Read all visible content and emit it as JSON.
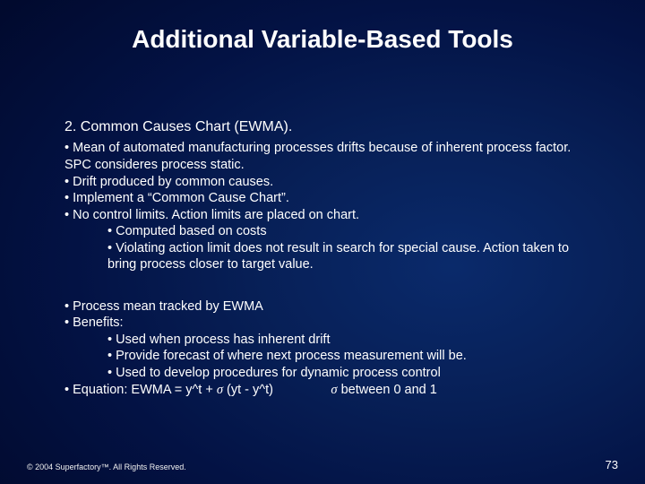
{
  "title": "Additional Variable-Based Tools",
  "heading": "2. Common Causes Chart (EWMA).",
  "block1": {
    "b1": "• Mean of automated manufacturing processes drifts because of inherent process factor. SPC consideres process static.",
    "b2": "• Drift produced by common causes.",
    "b3": "• Implement a “Common Cause Chart”.",
    "b4": "• No control limits. Action limits are placed on chart.",
    "b4a": "• Computed based on costs",
    "b4b": "• Violating action limit does not result in search for special cause. Action taken to bring process closer to target value."
  },
  "block2": {
    "b1": "• Process mean tracked by EWMA",
    "b2": "• Benefits:",
    "b2a": "• Used when process has inherent drift",
    "b2b": "• Provide forecast of where next process measurement will be.",
    "b2c": "• Used to develop procedures for dynamic process control",
    "eq_prefix": "• Equation: EWMA = y^t + ",
    "eq_mid": " (yt - y^t)",
    "eq_gap": "                ",
    "eq_suffix": " between 0 and 1",
    "sigma": "σ"
  },
  "footer": {
    "left": "© 2004 Superfactory™. All Rights Reserved.",
    "page": "73"
  }
}
